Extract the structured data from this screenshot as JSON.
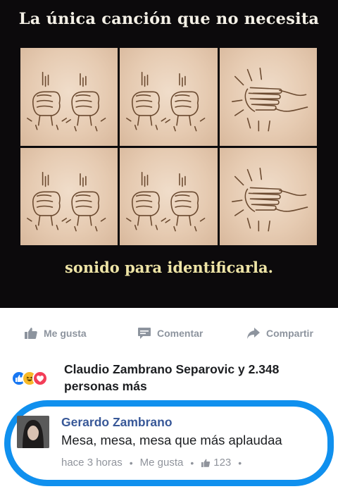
{
  "meme": {
    "top_caption": "La única canción que no necesita",
    "bottom_caption": "sonido para identificarla.",
    "panels": [
      {
        "gesture": "fists"
      },
      {
        "gesture": "fists"
      },
      {
        "gesture": "clap"
      },
      {
        "gesture": "fists"
      },
      {
        "gesture": "fists"
      },
      {
        "gesture": "clap"
      }
    ]
  },
  "post_actions": {
    "like_label": "Me gusta",
    "comment_label": "Comentar",
    "share_label": "Compartir",
    "like_icon": "thumbs-up-icon",
    "comment_icon": "speech-bubble-icon",
    "share_icon": "share-arrow-icon"
  },
  "reactions": {
    "icons": [
      "like-reaction-icon",
      "haha-reaction-icon",
      "love-reaction-icon"
    ],
    "summary": "Claudio Zambrano Separovic y 2.348 personas más"
  },
  "comment": {
    "author": "Gerardo Zambrano",
    "text": "Mesa, mesa, mesa que más aplaudaa",
    "time": "hace 3 horas",
    "like_label": "Me gusta",
    "like_count": "123"
  },
  "colors": {
    "facebook_blue": "#1877f2",
    "highlight_circle": "#1090ee",
    "name_link": "#385898",
    "meta_gray": "#90949c"
  }
}
